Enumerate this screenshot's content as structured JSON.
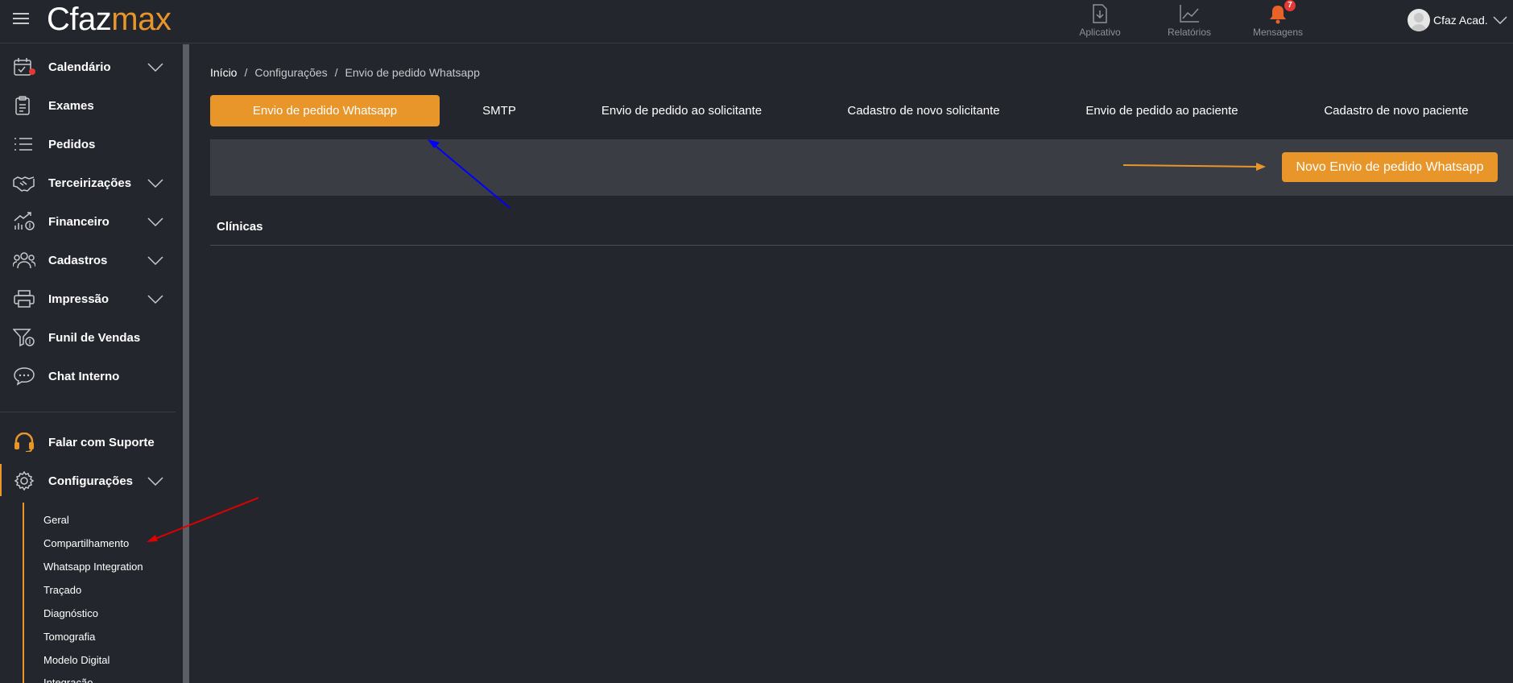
{
  "app": {
    "logo_part1": "Cfaz",
    "logo_part2": "max"
  },
  "topnav": {
    "aplicativo": "Aplicativo",
    "relatorios": "Relatórios",
    "mensagens": "Mensagens",
    "mensagens_badge": "7"
  },
  "user": {
    "name": "Cfaz Acad."
  },
  "sidebar": {
    "items": [
      {
        "label": "Calendário"
      },
      {
        "label": "Exames"
      },
      {
        "label": "Pedidos"
      },
      {
        "label": "Terceirizações"
      },
      {
        "label": "Financeiro"
      },
      {
        "label": "Cadastros"
      },
      {
        "label": "Impressão"
      },
      {
        "label": "Funil de Vendas"
      },
      {
        "label": "Chat Interno"
      }
    ],
    "support": "Falar com Suporte",
    "settings": "Configurações",
    "settings_sub": [
      "Geral",
      "Compartilhamento",
      "Whatsapp Integration",
      "Traçado",
      "Diagnóstico",
      "Tomografia",
      "Modelo Digital",
      "Integração"
    ]
  },
  "breadcrumb": {
    "home": "Início",
    "level1": "Configurações",
    "level2": "Envio de pedido Whatsapp"
  },
  "tabs": [
    "Envio de pedido Whatsapp",
    "SMTP",
    "Envio de pedido ao solicitante",
    "Cadastro de novo solicitante",
    "Envio de pedido ao paciente",
    "Cadastro de novo paciente"
  ],
  "panel": {
    "new_button": "Novo Envio de pedido Whatsapp"
  },
  "section": {
    "title": "Clínicas"
  },
  "colors": {
    "accent": "#e8952a",
    "background": "#23262c",
    "panel": "#3a3d44",
    "badge": "#e53935",
    "annotation_blue": "#0000ff",
    "annotation_red": "#e00000",
    "annotation_orange": "#e8952a"
  }
}
